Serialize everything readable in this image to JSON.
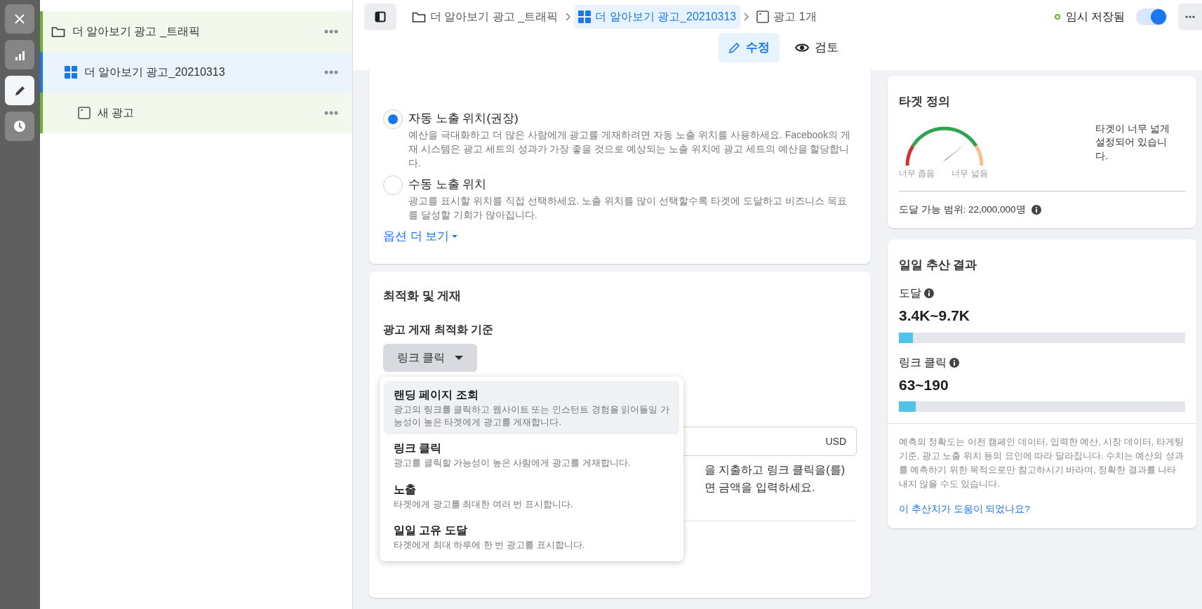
{
  "rail": {
    "buttons": [
      {
        "kind": "close",
        "selected": false
      },
      {
        "kind": "chart",
        "selected": false
      },
      {
        "kind": "edit",
        "selected": true
      },
      {
        "kind": "history",
        "selected": false
      }
    ]
  },
  "tree": [
    {
      "label": "더 알아보기 광고 _트래픽",
      "kind": "campaign",
      "selected": false,
      "children": [
        {
          "label": "더 알아보기 광고_20210313",
          "kind": "adset",
          "selected": true,
          "children": [
            {
              "label": "새 광고",
              "kind": "ad",
              "selected": false
            }
          ]
        }
      ]
    }
  ],
  "breadcrumb": [
    {
      "label": "더 알아보기 광고 _트래픽",
      "kind": "campaign",
      "selected": false
    },
    {
      "label": "더 알아보기 광고_20210313",
      "kind": "adset",
      "selected": true
    },
    {
      "label": "광고 1개",
      "kind": "ad",
      "selected": false
    }
  ],
  "save_status": "임시 저장됨",
  "toggle": {
    "on": true
  },
  "mode_tabs": [
    {
      "label": "수정",
      "kind": "edit",
      "selected": true
    },
    {
      "label": "검토",
      "kind": "review",
      "selected": false
    }
  ],
  "placements": {
    "options": [
      {
        "label": "자동 노출 위치(권장)",
        "description": "예산을 극대화하고 더 많은 사람에게 광고를 게재하려면 자동 노출 위치를 사용하세요. Facebook의 게재 시스템은 광고 세트의 성과가 가장 좋을 것으로 예상되는 노출 위치에 광고 세트의 예산을 할당합니다.",
        "selected": true
      },
      {
        "label": "수동 노출 위치",
        "description": "광고를 표시할 위치를 직접 선택하세요. 노출 위치를 많이 선택할수록 타겟에 도달하고 비즈니스 목표를 달성할 기회가 많아집니다.",
        "selected": false
      }
    ],
    "more_link": "옵션 더 보기"
  },
  "optimization": {
    "title": "최적화 및 게재",
    "field_label": "광고 게재 최적화 기준",
    "dropdown": {
      "value": "링크 클릭",
      "expanded": true,
      "options": [
        {
          "label": "랜딩 페이지 조회",
          "description": "광고의 링크를 클릭하고 웹사이트 또는 인스턴트 경험을 읽어들일 가능성이 높은 타겟에게 광고를 게재합니다.",
          "highlighted": true
        },
        {
          "label": "링크 클릭",
          "description": "광고를 클릭할 가능성이 높은 사람에게 광고를 게재합니다.",
          "highlighted": false
        },
        {
          "label": "노출",
          "description": "타겟에게 광고를 최대한 여러 번 표시합니다.",
          "highlighted": false
        },
        {
          "label": "일일 고유 도달",
          "description": "타겟에게 최대 하루에 한 번 광고를 표시합니다.",
          "highlighted": false
        }
      ]
    },
    "currency": "USD",
    "hint_lines": [
      "을 지출하고 링크 클릭을(를)",
      "면 금액을 입력하세요."
    ]
  },
  "audience": {
    "title": "타겟 정의",
    "gauge": {
      "low_label": "너무 좁음",
      "high_label": "너무 넓음"
    },
    "message": "타겟이 너무 넓게 설정되어 있습니다.",
    "reach": "도달 가능 범위: 22,000,000명"
  },
  "estimates": {
    "title": "일일 추산 결과",
    "metrics": [
      {
        "label": "도달",
        "value": "3.4K~9.7K",
        "level": 0.05
      },
      {
        "label": "링크 클릭",
        "value": "63~190",
        "level": 0.06
      }
    ],
    "disclaimer": "예측의 정확도는 이전 캠페인 데이터, 입력한 예산, 시장 데이터, 타게팅 기준, 광고 노출 위치 등의 요인에 따라 달라집니다. 수치는 예산의 성과를 예측하기 위한 목적으로만 참고하시기 바라며, 정확한 결과를 나타내지 않을 수도 있습니다.",
    "feedback_link": "이 추산치가 도움이 되었나요?"
  }
}
